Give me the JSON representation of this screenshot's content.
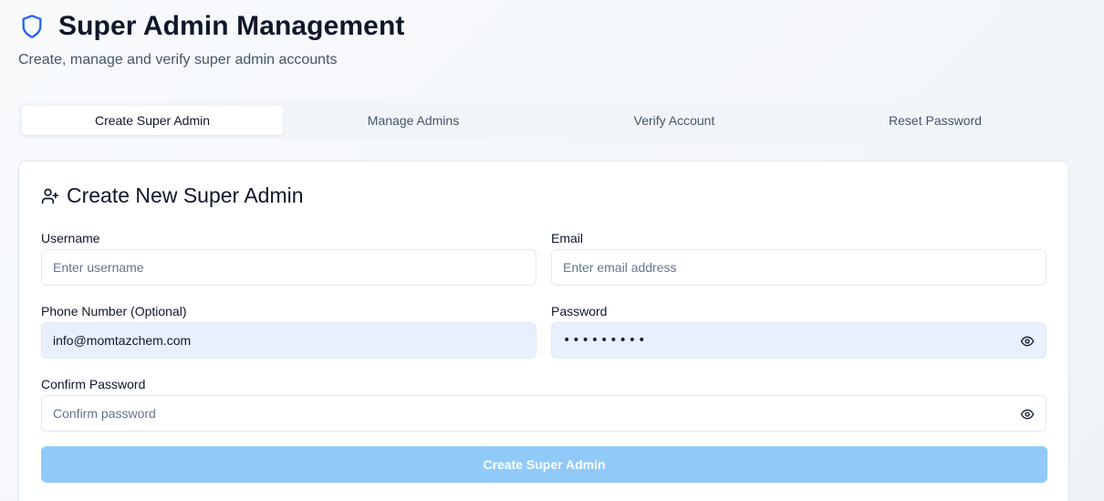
{
  "header": {
    "icon": "shield-icon",
    "title": "Super Admin Management",
    "subtitle": "Create, manage and verify super admin accounts"
  },
  "tabs": [
    {
      "label": "Create Super Admin",
      "active": true
    },
    {
      "label": "Manage Admins",
      "active": false
    },
    {
      "label": "Verify Account",
      "active": false
    },
    {
      "label": "Reset Password",
      "active": false
    }
  ],
  "form": {
    "title_icon": "user-plus-icon",
    "title": "Create New Super Admin",
    "username": {
      "label": "Username",
      "value": "",
      "placeholder": "Enter username"
    },
    "email": {
      "label": "Email",
      "value": "",
      "placeholder": "Enter email address"
    },
    "phone": {
      "label": "Phone Number (Optional)",
      "value": "info@momtazchem.com",
      "placeholder": ""
    },
    "password": {
      "label": "Password",
      "value_masked": "•••••••••",
      "toggle_icon": "eye-icon"
    },
    "confirm_password": {
      "label": "Confirm Password",
      "value": "",
      "placeholder": "Confirm password",
      "toggle_icon": "eye-icon"
    },
    "submit_label": "Create Super Admin"
  },
  "colors": {
    "accent": "#2563eb",
    "submit_bg": "#90caf9",
    "autofill_bg": "#e8f0fe"
  }
}
